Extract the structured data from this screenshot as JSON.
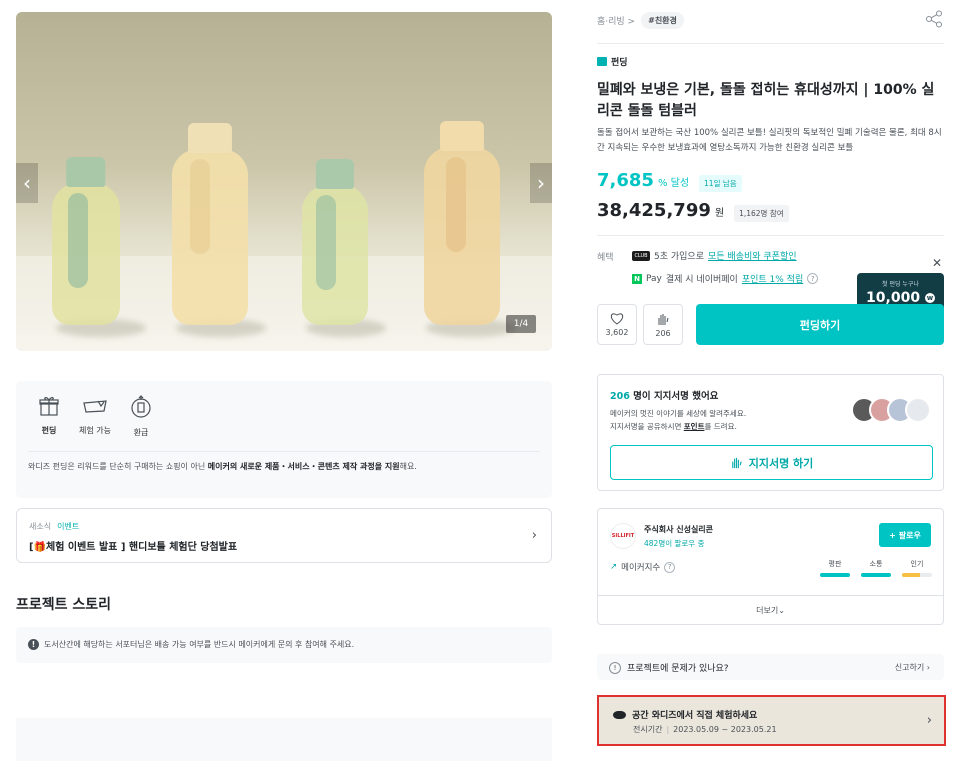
{
  "hero": {
    "counter": "1/4",
    "prev_icon": "chevron-left",
    "next_icon": "chevron-right"
  },
  "info": {
    "items": [
      {
        "label": "펀딩",
        "icon": "gift-icon"
      },
      {
        "label": "체험 가능",
        "icon": "card-icon"
      },
      {
        "label": "환급",
        "icon": "refund-icon"
      }
    ],
    "desc_prefix": "와디즈 펀딩은 리워드를 단순히 구매하는 쇼핑이 아닌 ",
    "desc_bold": "메이커의 새로운 제품・서비스・콘텐츠 제작 과정을 지원",
    "desc_suffix": "해요."
  },
  "news": {
    "tag1": "새소식",
    "tag2": "이벤트",
    "title": "[🎁체험 이벤트 발표 ] 핸디보틀 체험단 당첨발표"
  },
  "story": {
    "title": "프로젝트 스토리",
    "notice": "도서산간에 해당하는 서포터님은 배송 가능 여부를 반드시 메이커에게 문의 후 참여해 주세요."
  },
  "breadcrumb": {
    "path": "홈·리빙 >",
    "tag": "#친환경"
  },
  "project": {
    "type": "펀딩",
    "title": "밀폐와 보냉은 기본, 돌돌 접히는 휴대성까지 | 100% 실리콘 돌돌 텀블러",
    "summary": "돌돌 접어서 보관하는 국산 100% 실리콘 보틀! 실리핏의 독보적인 밀폐 기술력은 물론, 최대 8시간 지속되는 우수한 보냉효과에 열탕소독까지 가능한 친환경 실리콘 보틀",
    "rate": "7,685",
    "rate_unit": "% 달성",
    "days_left": "11일 남음",
    "amount": "38,425,799",
    "amount_unit": "원",
    "participants": "1,162명 참여"
  },
  "benefit": {
    "label": "혜택",
    "club_badge": "CLUB",
    "line1_prefix": "5초 가입으로 ",
    "line1_link": "모든 배송비와 쿠폰할인",
    "npay_badge": "N",
    "line2_brand": "Pay",
    "line2_mid": "결제 시 네이버페이 ",
    "line2_link": "포인트 1% 적립"
  },
  "actions": {
    "like_count": "3,602",
    "cheer_count": "206",
    "fund_label": "펀딩하기",
    "tooltip_caption": "첫 펀딩 누구나",
    "tooltip_amount": "10,000",
    "tooltip_unit": "w"
  },
  "support": {
    "count": "206",
    "heading_suffix": " 명이 지지서명 했어요",
    "desc1": "메이커의 멋진 이야기를 세상에 알려주세요.",
    "desc2_prefix": "지지서명을 공유하시면 ",
    "desc2_link": "포인트",
    "desc2_suffix": "를 드려요.",
    "button": "지지서명 하기"
  },
  "maker": {
    "logo_text": "SILLIFIT",
    "name": "주식회사 신성실리콘",
    "followers": "482명이 팔로우 중",
    "follow_label": "팔로우",
    "index_label": "메이커지수",
    "metrics": [
      {
        "label": "평판",
        "value": 1.0,
        "color": "#00c4c4"
      },
      {
        "label": "소통",
        "value": 1.0,
        "color": "#00c4c4"
      },
      {
        "label": "인기",
        "value": 0.6,
        "color": "#f6c042"
      }
    ],
    "more": "더보기"
  },
  "report": {
    "label": "프로젝트에 문제가 있나요?",
    "action": "신고하기"
  },
  "space": {
    "title": "공간 와디즈에서 직접 체험하세요",
    "period_label": "전시기간",
    "period": "2023.05.09 ~ 2023.05.21"
  }
}
